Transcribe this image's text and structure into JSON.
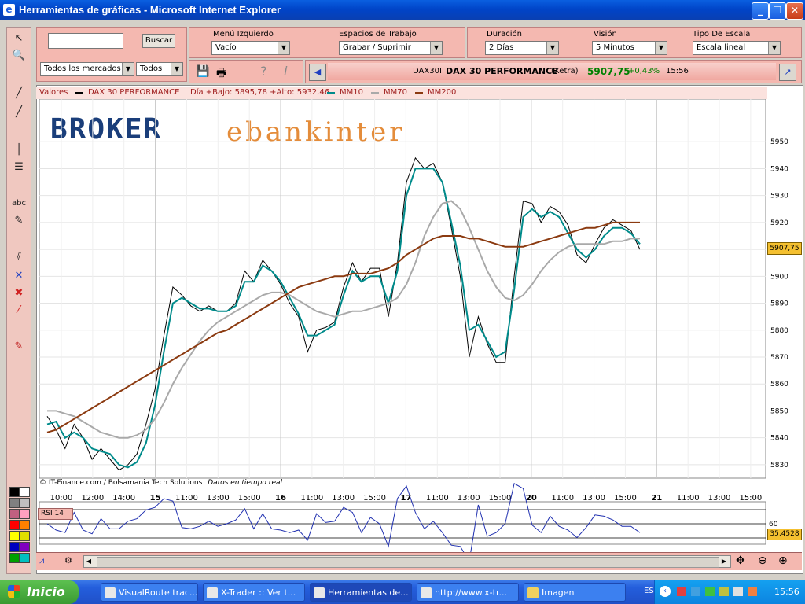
{
  "window": {
    "title": "Herramientas de gráficas - Microsoft Internet Explorer"
  },
  "search": {
    "button": "Buscar",
    "markets": "Todos los mercados",
    "all": "Todos"
  },
  "workspace": {
    "menu_label": "Menú Izquierdo",
    "menu_value": "Vacío",
    "spaces_label": "Espacios de Trabajo",
    "spaces_value": "Grabar / Suprimir",
    "duration_label": "Duración",
    "duration_value": "2 Días",
    "vision_label": "Visión",
    "vision_value": "5 Minutos",
    "scale_label": "Tipo De Escala",
    "scale_value": "Escala lineal"
  },
  "quote": {
    "symbol": "DAX30I",
    "name": "DAX 30 PERFORMANCE",
    "exchange": "(Xetra)",
    "price": "5907,75",
    "change": "+0,43%",
    "time": "15:56"
  },
  "legend": {
    "valores": "Valores",
    "series_name": "DAX 30 PERFORMANCE",
    "range": "Día +Bajo: 5895,78 +Alto: 5932,46",
    "ma10": "MM10",
    "ma70": "MM70",
    "ma200": "MM200"
  },
  "logo": {
    "broker": "BROKER",
    "bank": "ebankinter"
  },
  "credits": {
    "source": "© IT-Finance.com / Bolsamania Tech Solutions",
    "realtime": "Datos en tiempo real"
  },
  "rsi": {
    "label": "RSI 14",
    "value_tag": "35,4528",
    "level_tag": "60"
  },
  "price_tag": "5907,75",
  "icons": [
    "arrow-icon",
    "zoom-icon",
    "line-icon",
    "text-icon",
    "pencil-icon",
    "delete-icon",
    "printer-icon",
    "save-icon",
    "help-icon",
    "info-icon"
  ],
  "taskbar": {
    "start": "Inicio",
    "tasks": [
      "VisualRoute trac...",
      "X-Trader :: Ver t...",
      "Herramientas de...",
      "http://www.x-tr...",
      "Imagen"
    ],
    "lang": "ES",
    "clock": "15:56"
  },
  "chart_data": {
    "type": "line",
    "title": "DAX 30 PERFORMANCE",
    "ylim": [
      5825,
      5960
    ],
    "y_ticks": [
      5830,
      5840,
      5850,
      5860,
      5870,
      5880,
      5890,
      5900,
      5910,
      5920,
      5930,
      5940,
      5950
    ],
    "x_ticks": [
      "10:00",
      "12:00",
      "14:00",
      "15",
      "11:00",
      "13:00",
      "15:00",
      "16",
      "11:00",
      "13:00",
      "15:00",
      "17",
      "11:00",
      "13:00",
      "15:00",
      "20",
      "11:00",
      "13:00",
      "15:00",
      "21",
      "11:00",
      "13:00",
      "15:00"
    ],
    "series": [
      {
        "name": "DAX 30 PERFORMANCE",
        "color": "#000000",
        "values": [
          5848,
          5843,
          5836,
          5845,
          5840,
          5832,
          5836,
          5832,
          5828,
          5830,
          5834,
          5845,
          5858,
          5878,
          5896,
          5893,
          5889,
          5887,
          5889,
          5887,
          5887,
          5890,
          5902,
          5898,
          5906,
          5902,
          5897,
          5890,
          5885,
          5872,
          5880,
          5881,
          5883,
          5896,
          5905,
          5898,
          5903,
          5903,
          5885,
          5905,
          5935,
          5944,
          5940,
          5942,
          5935,
          5918,
          5900,
          5870,
          5885,
          5875,
          5868,
          5868,
          5900,
          5928,
          5927,
          5920,
          5926,
          5924,
          5919,
          5908,
          5905,
          5912,
          5918,
          5921,
          5919,
          5917,
          5910
        ]
      },
      {
        "name": "MM10",
        "color": "#008b8b",
        "values": [
          5845,
          5846,
          5840,
          5842,
          5840,
          5836,
          5835,
          5834,
          5830,
          5829,
          5831,
          5838,
          5852,
          5872,
          5890,
          5892,
          5890,
          5888,
          5888,
          5887,
          5887,
          5889,
          5898,
          5898,
          5904,
          5902,
          5898,
          5892,
          5886,
          5878,
          5878,
          5880,
          5882,
          5893,
          5902,
          5898,
          5900,
          5900,
          5890,
          5902,
          5930,
          5940,
          5940,
          5940,
          5935,
          5920,
          5904,
          5880,
          5882,
          5876,
          5870,
          5872,
          5895,
          5922,
          5925,
          5922,
          5924,
          5922,
          5916,
          5910,
          5907,
          5910,
          5915,
          5918,
          5918,
          5916,
          5912
        ]
      },
      {
        "name": "MM70",
        "color": "#a9a9a9",
        "values": [
          5850,
          5850,
          5849,
          5848,
          5846,
          5844,
          5842,
          5841,
          5840,
          5840,
          5841,
          5843,
          5847,
          5853,
          5860,
          5866,
          5871,
          5876,
          5880,
          5883,
          5885,
          5887,
          5889,
          5891,
          5893,
          5894,
          5894,
          5893,
          5891,
          5889,
          5887,
          5886,
          5885,
          5886,
          5887,
          5887,
          5888,
          5889,
          5890,
          5892,
          5897,
          5905,
          5915,
          5922,
          5927,
          5928,
          5925,
          5918,
          5910,
          5902,
          5896,
          5892,
          5891,
          5893,
          5897,
          5902,
          5906,
          5909,
          5911,
          5912,
          5912,
          5912,
          5912,
          5913,
          5913,
          5914,
          5914
        ]
      },
      {
        "name": "MM200",
        "color": "#8b3a10",
        "values": [
          5842,
          5843,
          5845,
          5847,
          5849,
          5851,
          5853,
          5855,
          5857,
          5859,
          5861,
          5863,
          5865,
          5867,
          5869,
          5871,
          5873,
          5875,
          5877,
          5879,
          5880,
          5882,
          5884,
          5886,
          5888,
          5890,
          5892,
          5894,
          5896,
          5897,
          5898,
          5899,
          5900,
          5900,
          5901,
          5901,
          5901,
          5902,
          5903,
          5905,
          5908,
          5910,
          5912,
          5914,
          5915,
          5915,
          5915,
          5914,
          5914,
          5913,
          5912,
          5911,
          5911,
          5911,
          5912,
          5913,
          5914,
          5915,
          5916,
          5917,
          5918,
          5918,
          5919,
          5920,
          5920,
          5920,
          5920
        ]
      }
    ]
  }
}
